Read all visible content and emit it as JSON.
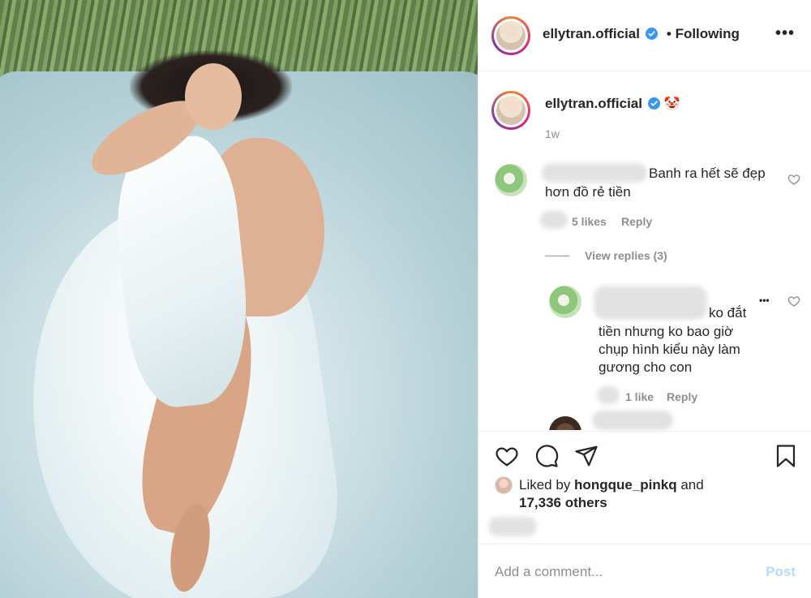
{
  "post": {
    "username": "ellytran.official",
    "follow_status": "• Following",
    "more_glyph": "•••",
    "photo_alt": "Photo post"
  },
  "caption": {
    "username": "ellytran.official",
    "emoji": "🤡",
    "time": "1w"
  },
  "comments": [
    {
      "text_line1": "Banh ra hết sẽ đẹp",
      "text_line2": "hơn đồ rẻ tiền",
      "likes": "5 likes",
      "reply": "Reply",
      "view_replies": "View replies (3)"
    }
  ],
  "reply": {
    "text_line1": "ko đắt",
    "text_line2": "tiền nhưng ko bao giờ",
    "text_line3": "chụp hình kiểu này làm",
    "text_line4": "gương cho con",
    "likes": "1 like",
    "reply": "Reply",
    "more_glyph": "•••"
  },
  "likes": {
    "prefix": "Liked by ",
    "user": "hongque_pinkq",
    "and": " and",
    "others": "17,336 others"
  },
  "comment_input": {
    "placeholder": "Add a comment...",
    "post_label": "Post"
  },
  "colors": {
    "verified": "#3897f0",
    "muted": "#8e8e8e",
    "post_disabled": "#b3dbff"
  }
}
